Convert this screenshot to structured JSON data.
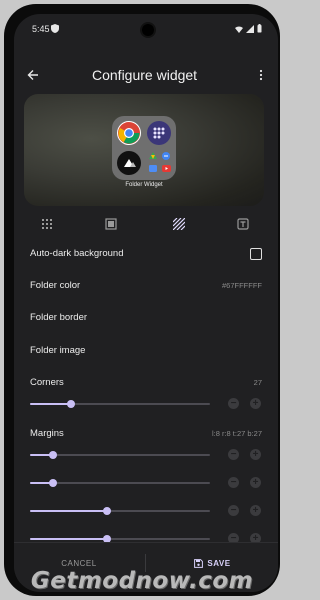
{
  "status_bar": {
    "time": "5:45"
  },
  "app_bar": {
    "title": "Configure widget"
  },
  "preview": {
    "folder_label": "Folder Widget"
  },
  "settings": {
    "auto_dark": {
      "label": "Auto-dark background",
      "checked": false
    },
    "folder_color": {
      "label": "Folder color",
      "value": "#67FFFFFF"
    },
    "folder_border": {
      "label": "Folder border"
    },
    "folder_image": {
      "label": "Folder image"
    },
    "corners": {
      "label": "Corners",
      "value": "27",
      "level": 0.23
    },
    "margins": {
      "label": "Margins",
      "value": "l:8 r:8 t:27 b:27",
      "levels": [
        0.13,
        0.13,
        0.43,
        0.43
      ]
    }
  },
  "colors": {
    "accent": "#c9bff5",
    "background": "#202022"
  },
  "bottom_bar": {
    "cancel_label": "CANCEL",
    "save_label": "SAVE"
  },
  "watermark": {
    "text": "Getmodnow.com"
  }
}
